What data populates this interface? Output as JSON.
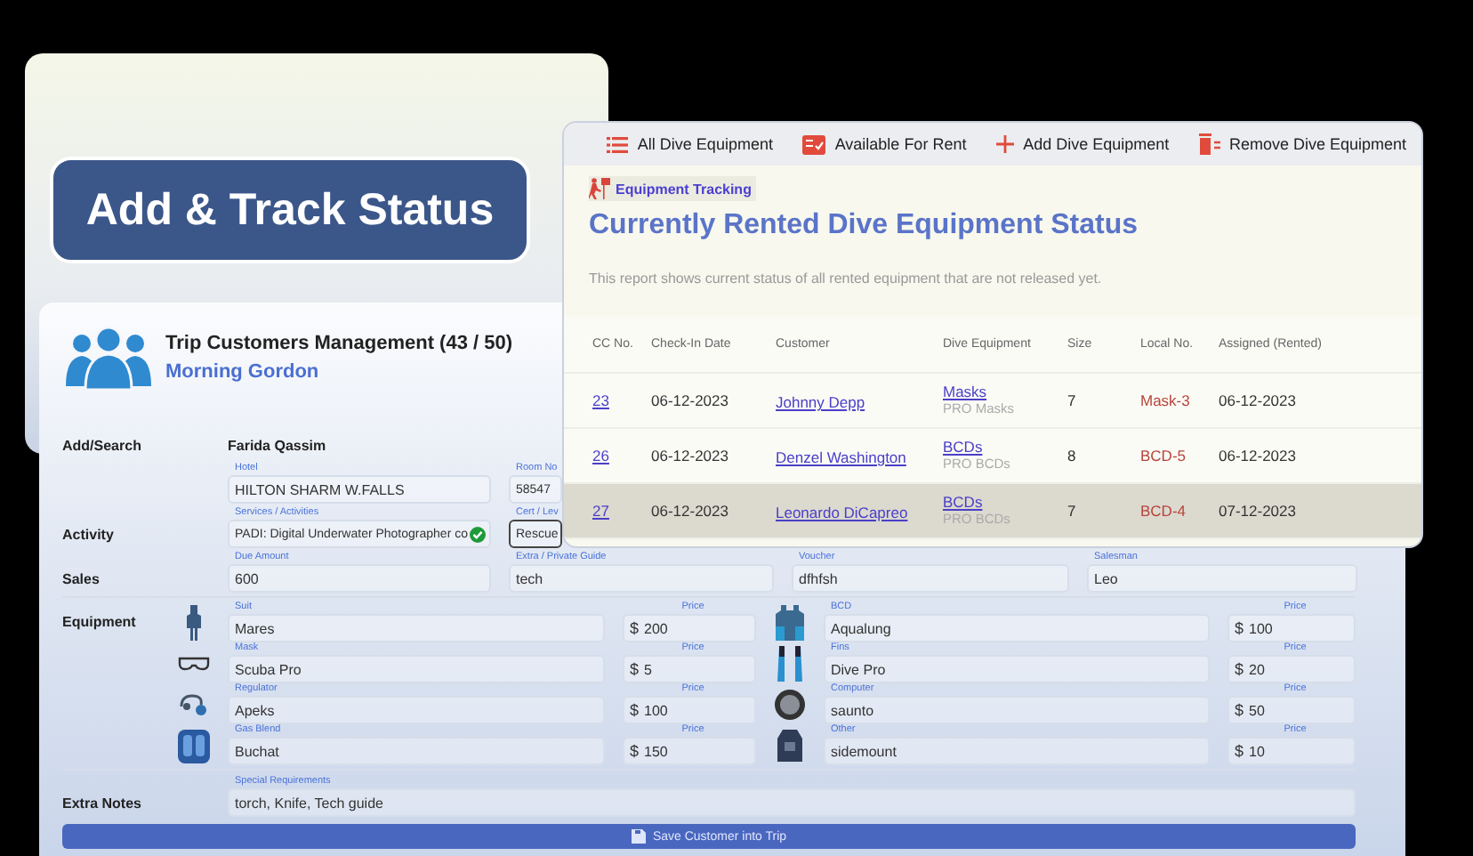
{
  "badge": {
    "title": "Add & Track Status"
  },
  "customer_form": {
    "title": "Trip Customers Management (43 / 50)",
    "trip": "Morning Gordon",
    "add_search": {
      "label": "Add/Search",
      "value": "Farida Qassim"
    },
    "hotel": {
      "label": "Hotel",
      "value": "HILTON SHARM W.FALLS"
    },
    "room": {
      "label": "Room No",
      "value": "58547"
    },
    "activity_label": "Activity",
    "services": {
      "label": "Services / Activities",
      "value": "PADI: Digital Underwater Photographer co",
      "verified": true
    },
    "cert": {
      "label": "Cert / Lev",
      "value": "Rescue",
      "focused": true
    },
    "sales_label": "Sales",
    "sales_fields": [
      {
        "label": "Due Amount",
        "value": "600"
      },
      {
        "label": "Extra / Private Guide",
        "value": "tech"
      },
      {
        "label": "Voucher",
        "value": "dfhfsh"
      },
      {
        "label": "Salesman",
        "value": "Leo"
      }
    ],
    "equipment_label": "Equipment",
    "equipment": [
      {
        "kind": "suit",
        "label": "Suit",
        "value": "Mares",
        "price_label": "Price",
        "currency": "$",
        "price": "200"
      },
      {
        "kind": "bcd",
        "label": "BCD",
        "value": "Aqualung",
        "price_label": "Price",
        "currency": "$",
        "price": "100"
      },
      {
        "kind": "mask",
        "label": "Mask",
        "value": "Scuba Pro",
        "price_label": "Price",
        "currency": "$",
        "price": "5"
      },
      {
        "kind": "fins",
        "label": "Fins",
        "value": "Dive Pro",
        "price_label": "Price",
        "currency": "$",
        "price": "20"
      },
      {
        "kind": "regulator",
        "label": "Regulator",
        "value": "Apeks",
        "price_label": "Price",
        "currency": "$",
        "price": "100"
      },
      {
        "kind": "computer",
        "label": "Computer",
        "value": "saunto",
        "price_label": "Price",
        "currency": "$",
        "price": "50"
      },
      {
        "kind": "tank",
        "label": "Gas Blend",
        "value": "Buchat",
        "price_label": "Price",
        "currency": "$",
        "price": "150"
      },
      {
        "kind": "other",
        "label": "Other",
        "value": "sidemount",
        "price_label": "Price",
        "currency": "$",
        "price": "10"
      }
    ],
    "notes": {
      "label": "Extra Notes",
      "field_label": "Special Requirements",
      "value": "torch, Knife, Tech guide"
    },
    "save_button": "Save Customer into Trip"
  },
  "rental": {
    "toolbar": [
      {
        "kind": "list",
        "label": "All Dive Equipment"
      },
      {
        "kind": "available",
        "label": "Available For Rent"
      },
      {
        "kind": "add",
        "label": "Add Dive Equipment"
      },
      {
        "kind": "remove",
        "label": "Remove Dive Equipment"
      }
    ],
    "tag": "Equipment Tracking",
    "title": "Currently Rented Dive Equipment Status",
    "description": "This report shows current status of all rented equipment that are not released yet.",
    "columns": [
      "CC No.",
      "Check-In Date",
      "Customer",
      "Dive Equipment",
      "Size",
      "Local No.",
      "Assigned (Rented)"
    ],
    "rows": [
      {
        "cc": "23",
        "date": "06-12-2023",
        "customer": "Johnny Depp",
        "equipment": "Masks",
        "equipment_type": "PRO Masks",
        "size": "7",
        "local": "Mask-3",
        "assigned": "06-12-2023",
        "selected": false
      },
      {
        "cc": "26",
        "date": "06-12-2023",
        "customer": "Denzel Washington",
        "equipment": "BCDs",
        "equipment_type": "PRO BCDs",
        "size": "8",
        "local": "BCD-5",
        "assigned": "06-12-2023",
        "selected": false
      },
      {
        "cc": "27",
        "date": "06-12-2023",
        "customer": "Leonardo DiCapreo",
        "equipment": "BCDs",
        "equipment_type": "PRO BCDs",
        "size": "7",
        "local": "BCD-4",
        "assigned": "07-12-2023",
        "selected": true
      }
    ]
  }
}
